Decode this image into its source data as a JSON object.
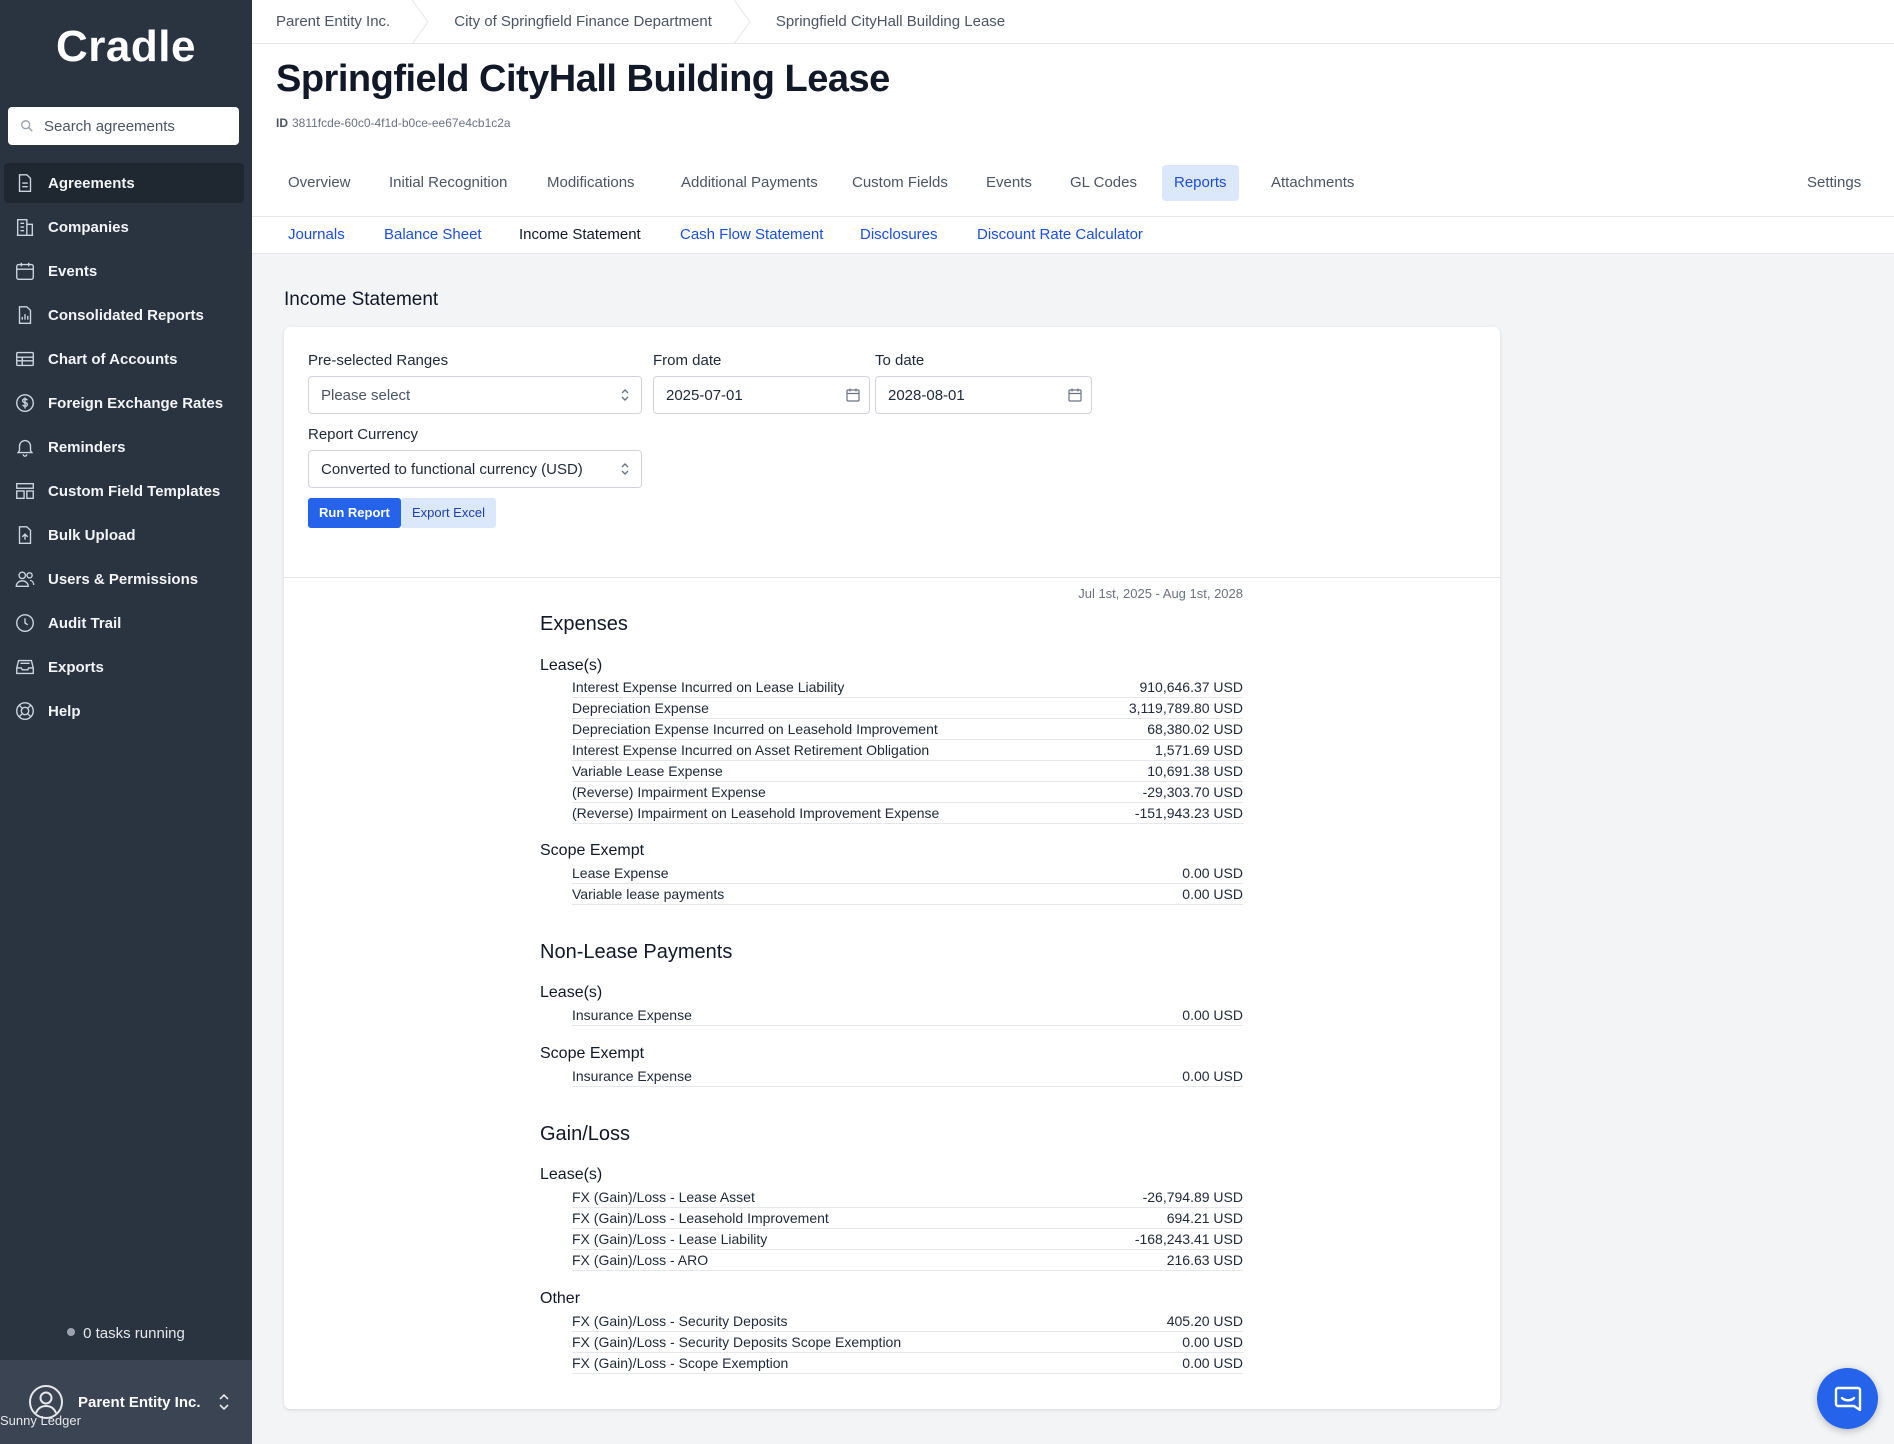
{
  "app": {
    "logo": "Cradle"
  },
  "search": {
    "placeholder": "Search agreements"
  },
  "sidebar": {
    "items": [
      {
        "label": "Agreements",
        "icon": "document-icon"
      },
      {
        "label": "Companies",
        "icon": "building-icon"
      },
      {
        "label": "Events",
        "icon": "calendar-icon"
      },
      {
        "label": "Consolidated Reports",
        "icon": "report-icon"
      },
      {
        "label": "Chart of Accounts",
        "icon": "table-icon"
      },
      {
        "label": "Foreign Exchange Rates",
        "icon": "currency-icon"
      },
      {
        "label": "Reminders",
        "icon": "bell-icon"
      },
      {
        "label": "Custom Field Templates",
        "icon": "template-icon"
      },
      {
        "label": "Bulk Upload",
        "icon": "upload-icon"
      },
      {
        "label": "Users & Permissions",
        "icon": "users-icon"
      },
      {
        "label": "Audit Trail",
        "icon": "clock-icon"
      },
      {
        "label": "Exports",
        "icon": "tray-icon"
      },
      {
        "label": "Help",
        "icon": "lifebuoy-icon"
      }
    ],
    "tasks": "0 tasks running",
    "account": {
      "name": "Parent Entity Inc.",
      "sub": "Sunny Ledger"
    }
  },
  "breadcrumb": [
    "Parent Entity Inc.",
    "City of Springfield Finance Department",
    "Springfield CityHall Building Lease"
  ],
  "page": {
    "title": "Springfield CityHall Building Lease",
    "id_label": "ID",
    "id_value": "3811fcde-60c0-4f1d-b0ce-ee67e4cb1c2a"
  },
  "tabs": [
    "Overview",
    "Initial Recognition",
    "Modifications",
    "Additional Payments",
    "Custom Fields",
    "Events",
    "GL Codes",
    "Reports",
    "Attachments",
    "Settings"
  ],
  "subtabs": [
    "Journals",
    "Balance Sheet",
    "Income Statement",
    "Cash Flow Statement",
    "Disclosures",
    "Discount Rate Calculator"
  ],
  "section_title": "Income Statement",
  "form": {
    "ranges_label": "Pre-selected Ranges",
    "ranges_placeholder": "Please select",
    "from_label": "From date",
    "from_value": "2025-07-01",
    "to_label": "To date",
    "to_value": "2028-08-01",
    "currency_label": "Report Currency",
    "currency_value": "Converted to functional currency (USD)",
    "run": "Run Report",
    "export": "Export Excel"
  },
  "report": {
    "period": "Jul 1st, 2025 - Aug 1st, 2028",
    "expenses": {
      "title": "Expenses",
      "lease_title": "Lease(s)",
      "lease": [
        {
          "label": "Interest Expense Incurred on Lease Liability",
          "value": "910,646.37 USD"
        },
        {
          "label": "Depreciation Expense",
          "value": "3,119,789.80 USD"
        },
        {
          "label": "Depreciation Expense Incurred on Leasehold Improvement",
          "value": "68,380.02 USD"
        },
        {
          "label": "Interest Expense Incurred on Asset Retirement Obligation",
          "value": "1,571.69 USD"
        },
        {
          "label": "Variable Lease Expense",
          "value": "10,691.38 USD"
        },
        {
          "label": "(Reverse) Impairment Expense",
          "value": "-29,303.70 USD"
        },
        {
          "label": "(Reverse) Impairment on Leasehold Improvement Expense",
          "value": "-151,943.23 USD"
        }
      ],
      "scope_title": "Scope Exempt",
      "scope": [
        {
          "label": "Lease Expense",
          "value": "0.00 USD"
        },
        {
          "label": "Variable lease payments",
          "value": "0.00 USD"
        }
      ]
    },
    "nonlease": {
      "title": "Non-Lease Payments",
      "lease_title": "Lease(s)",
      "lease": [
        {
          "label": "Insurance Expense",
          "value": "0.00 USD"
        }
      ],
      "scope_title": "Scope Exempt",
      "scope": [
        {
          "label": "Insurance Expense",
          "value": "0.00 USD"
        }
      ]
    },
    "gainloss": {
      "title": "Gain/Loss",
      "lease_title": "Lease(s)",
      "lease": [
        {
          "label": "FX (Gain)/Loss - Lease Asset",
          "value": "-26,794.89 USD"
        },
        {
          "label": "FX (Gain)/Loss - Leasehold Improvement",
          "value": "694.21 USD"
        },
        {
          "label": "FX (Gain)/Loss - Lease Liability",
          "value": "-168,243.41 USD"
        },
        {
          "label": "FX (Gain)/Loss - ARO",
          "value": "216.63 USD"
        }
      ],
      "other_title": "Other",
      "other": [
        {
          "label": "FX (Gain)/Loss - Security Deposits",
          "value": "405.20 USD"
        },
        {
          "label": "FX (Gain)/Loss - Security Deposits Scope Exemption",
          "value": "0.00 USD"
        },
        {
          "label": "FX (Gain)/Loss - Scope Exemption",
          "value": "0.00 USD"
        }
      ]
    }
  }
}
